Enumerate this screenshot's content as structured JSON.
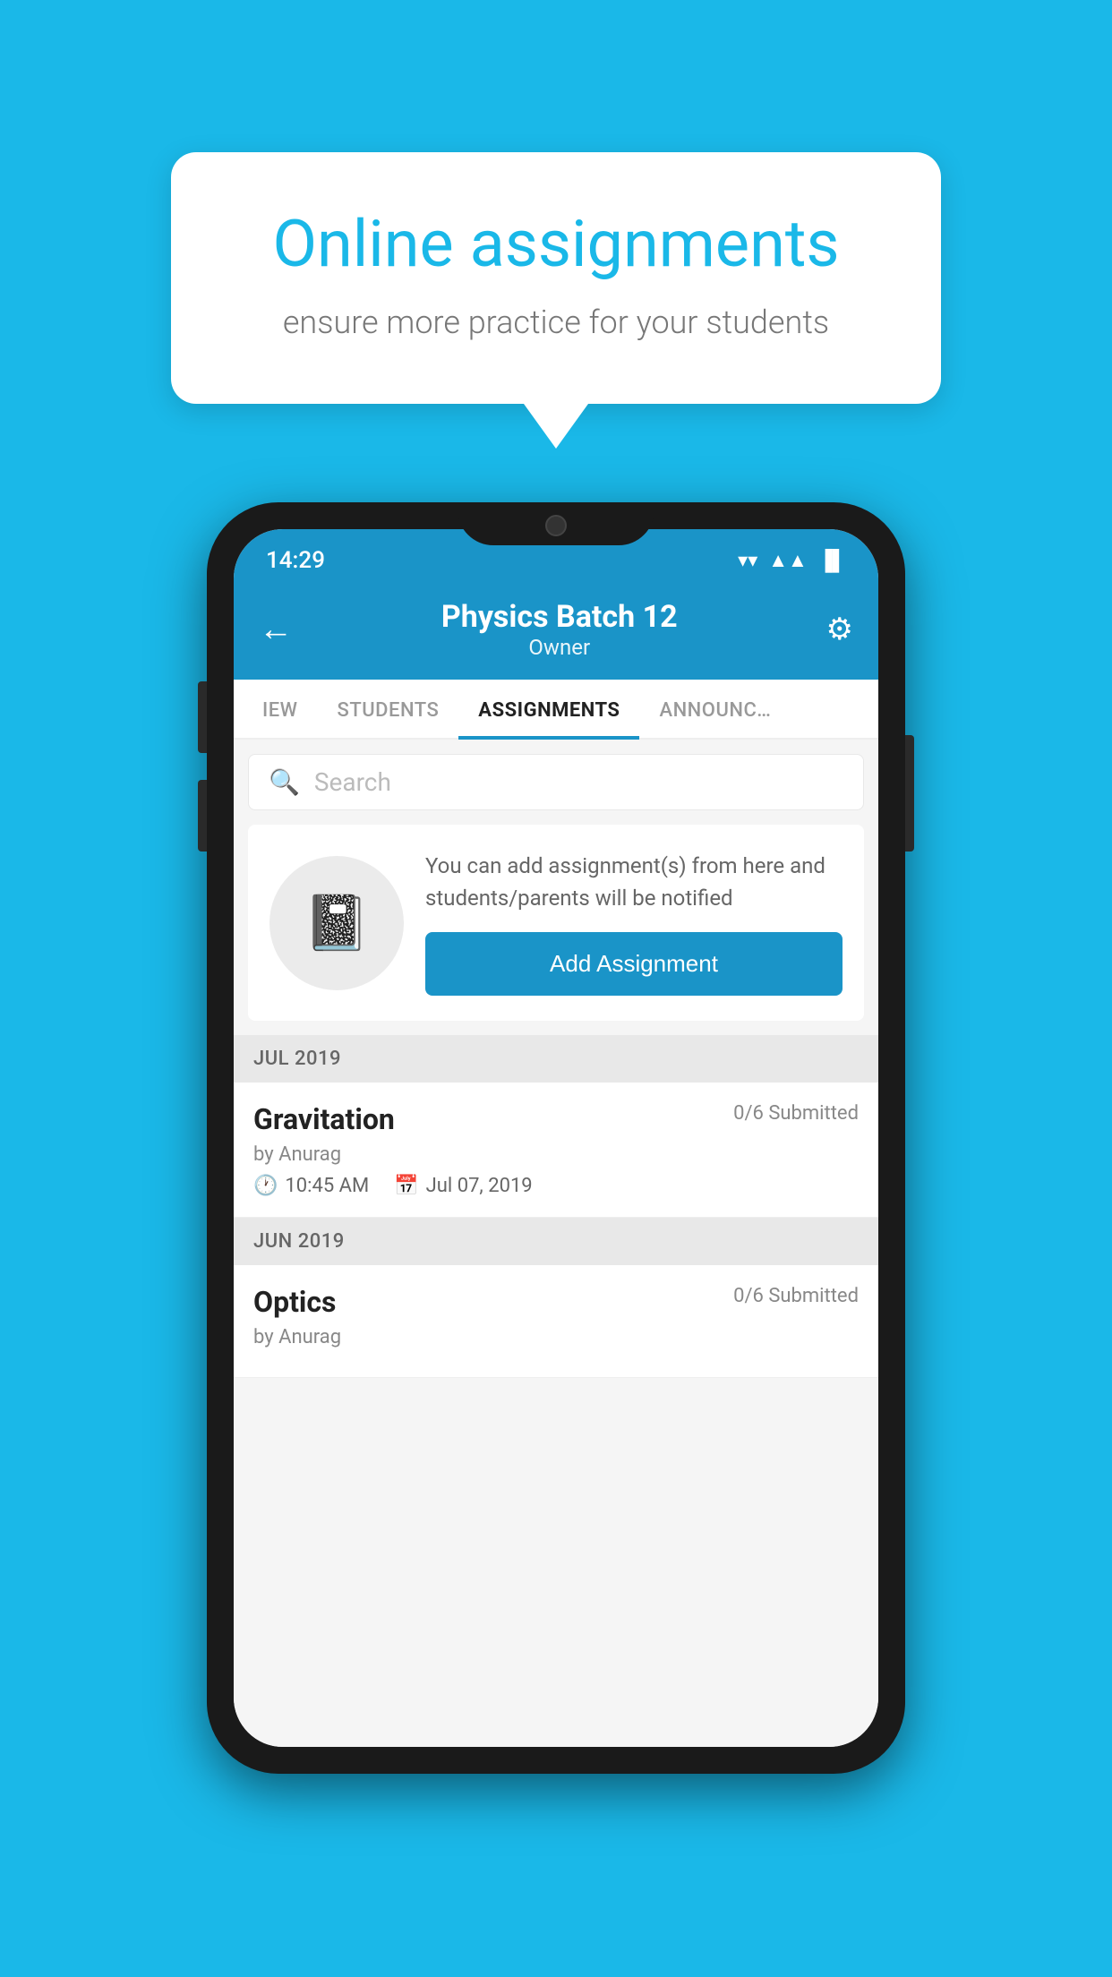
{
  "background_color": "#1ab8e8",
  "speech_bubble": {
    "title": "Online assignments",
    "subtitle": "ensure more practice for your students"
  },
  "status_bar": {
    "time": "14:29",
    "wifi": "▼",
    "signal": "▲",
    "battery": "▐"
  },
  "header": {
    "title": "Physics Batch 12",
    "subtitle": "Owner",
    "back_label": "←",
    "settings_label": "⚙"
  },
  "tabs": [
    {
      "label": "IEW",
      "active": false
    },
    {
      "label": "STUDENTS",
      "active": false
    },
    {
      "label": "ASSIGNMENTS",
      "active": true
    },
    {
      "label": "ANNOUNCEM…",
      "active": false
    }
  ],
  "search": {
    "placeholder": "Search"
  },
  "promo": {
    "text": "You can add assignment(s) from here and students/parents will be notified",
    "button_label": "Add Assignment"
  },
  "sections": [
    {
      "title": "JUL 2019",
      "assignments": [
        {
          "name": "Gravitation",
          "submitted": "0/6 Submitted",
          "author": "by Anurag",
          "time": "10:45 AM",
          "date": "Jul 07, 2019"
        }
      ]
    },
    {
      "title": "JUN 2019",
      "assignments": [
        {
          "name": "Optics",
          "submitted": "0/6 Submitted",
          "author": "by Anurag",
          "time": "",
          "date": ""
        }
      ]
    }
  ]
}
